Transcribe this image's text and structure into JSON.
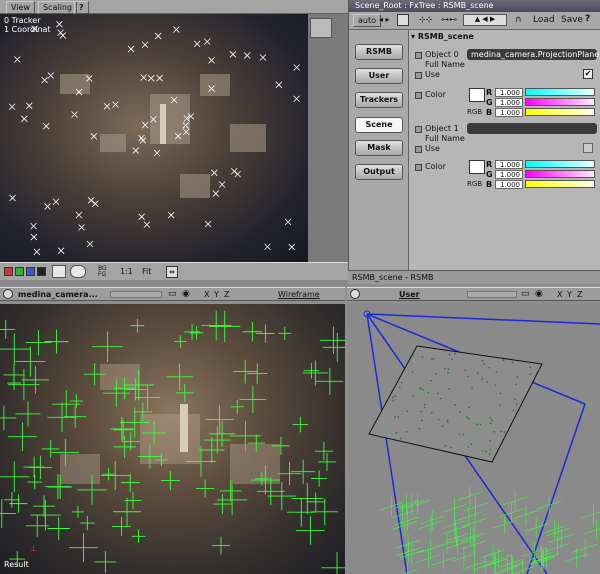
{
  "top_viewer": {
    "menu": [
      "View",
      "Scaling"
    ],
    "help": "?",
    "overlay_lines": [
      "0 Tracker",
      "1 Coordinat"
    ],
    "swatches": [
      "#c83a3a",
      "#3aa83a",
      "#3a5ac8",
      "#222222"
    ],
    "ratio": "1:1",
    "fit": "Fit"
  },
  "panel": {
    "title": "Scene_Root : FxTree : RSMB_scene",
    "auto": "auto",
    "load": "Load",
    "save": "Save",
    "help": "?",
    "tabs": [
      "RSMB",
      "User",
      "Trackers",
      "Scene",
      "Mask",
      "Output"
    ],
    "active_tab": "Scene",
    "section": "RSMB_scene",
    "obj0": {
      "label": "Object 0 Full Name",
      "value": "medina_camera.ProjectionPlane",
      "use_label": "Use",
      "color_label": "Color",
      "rgb_label": "RGB",
      "r": "1.000",
      "g": "1.000",
      "b": "1.000"
    },
    "obj1": {
      "label": "Object 1 Full Name",
      "value": "",
      "use_label": "Use",
      "color_label": "Color",
      "rgb_label": "RGB",
      "r": "1.000",
      "g": "1.000",
      "b": "1.000"
    },
    "channel_labels": [
      "R",
      "G",
      "B"
    ]
  },
  "status": "RSMB_scene - RSMB",
  "bottom_left": {
    "camera": "medina_camera...",
    "axes": [
      "X",
      "Y",
      "Z"
    ],
    "mode": "Wireframe",
    "result": "Result"
  },
  "bottom_right": {
    "camera": "User",
    "axes": [
      "X",
      "Y",
      "Z"
    ]
  },
  "colors": {
    "accent_blue": "#1a2ad8",
    "tracker_green": "#3cff3c"
  }
}
